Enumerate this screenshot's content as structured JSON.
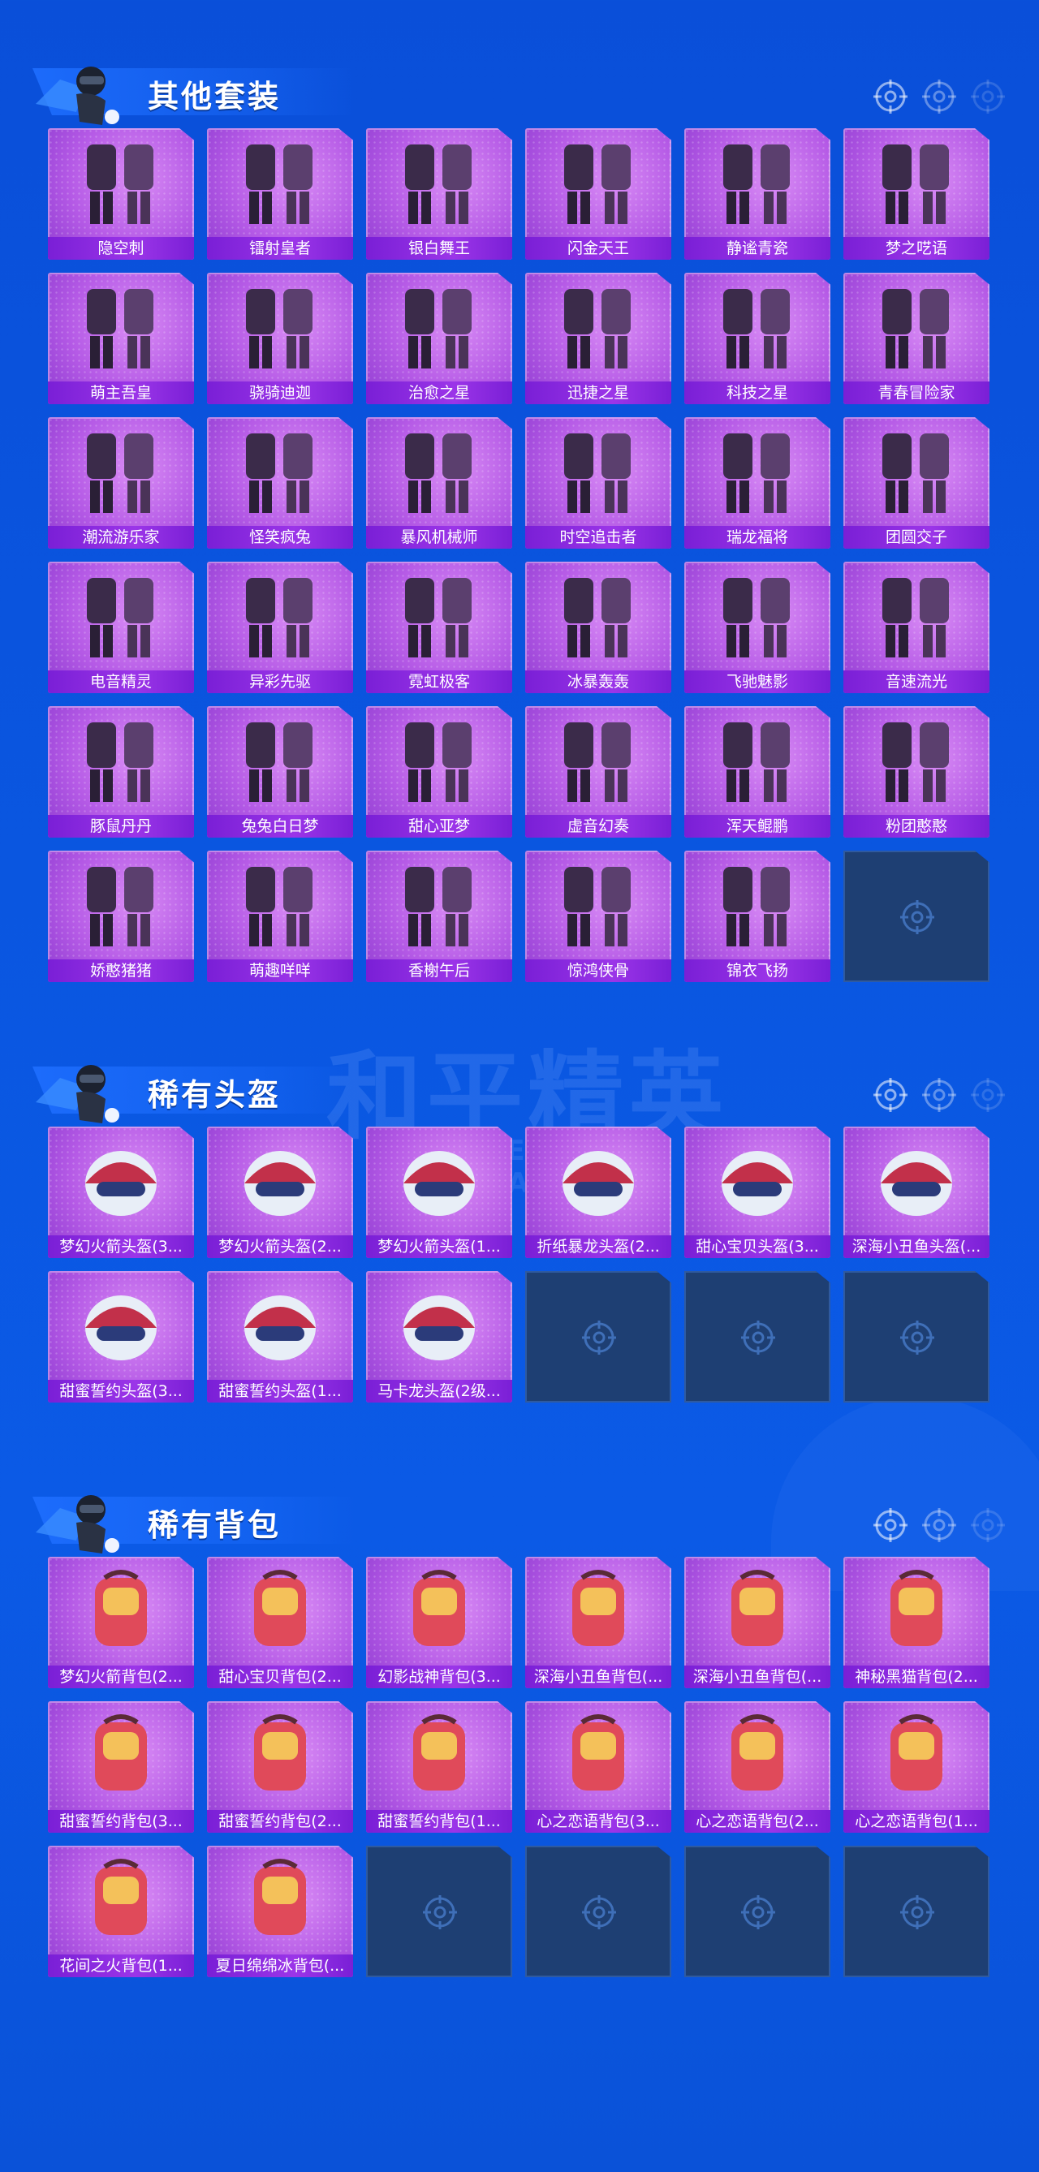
{
  "watermark": {
    "title": "和平精英",
    "subtitle": "GAME FOR PEACE"
  },
  "colors": {
    "background": "#0a56e0",
    "card": "#b55ae6",
    "label_bar": "#8a2be2",
    "empty_slot": "#1e3f73"
  },
  "sections": [
    {
      "title": "其他套装",
      "items": [
        "隐空刺",
        "镭射皇者",
        "银白舞王",
        "闪金天王",
        "静谧青瓷",
        "梦之呓语",
        "萌主吾皇",
        "骁骑迪迦",
        "治愈之星",
        "迅捷之星",
        "科技之星",
        "青春冒险家",
        "潮流游乐家",
        "怪笑疯兔",
        "暴风机械师",
        "时空追击者",
        "瑞龙福将",
        "团圆交子",
        "电音精灵",
        "异彩先驱",
        "霓虹极客",
        "冰暴轰轰",
        "飞驰魅影",
        "音速流光",
        "豚鼠丹丹",
        "兔兔白日梦",
        "甜心亚梦",
        "虚音幻奏",
        "浑天鲲鹏",
        "粉团憨憨",
        "娇憨猪猪",
        "萌趣咩咩",
        "香榭午后",
        "惊鸿侠骨",
        "锦衣飞扬"
      ],
      "empty_slots": 1
    },
    {
      "title": "稀有头盔",
      "items": [
        "梦幻火箭头盔(3...",
        "梦幻火箭头盔(2...",
        "梦幻火箭头盔(1...",
        "折纸暴龙头盔(2...",
        "甜心宝贝头盔(3...",
        "深海小丑鱼头盔(...",
        "甜蜜誓约头盔(3...",
        "甜蜜誓约头盔(1...",
        "马卡龙头盔(2级..."
      ],
      "empty_slots": 3
    },
    {
      "title": "稀有背包",
      "items": [
        "梦幻火箭背包(2...",
        "甜心宝贝背包(2...",
        "幻影战神背包(3...",
        "深海小丑鱼背包(...",
        "深海小丑鱼背包(...",
        "神秘黑猫背包(2...",
        "甜蜜誓约背包(3...",
        "甜蜜誓约背包(2...",
        "甜蜜誓约背包(1...",
        "心之恋语背包(3...",
        "心之恋语背包(2...",
        "心之恋语背包(1...",
        "花间之火背包(1...",
        "夏日绵绵冰背包(..."
      ],
      "empty_slots": 4
    }
  ],
  "icons": {
    "section_avatar": "soldier-avatar-icon",
    "target": "crosshair-icon",
    "empty": "crosshair-icon"
  }
}
